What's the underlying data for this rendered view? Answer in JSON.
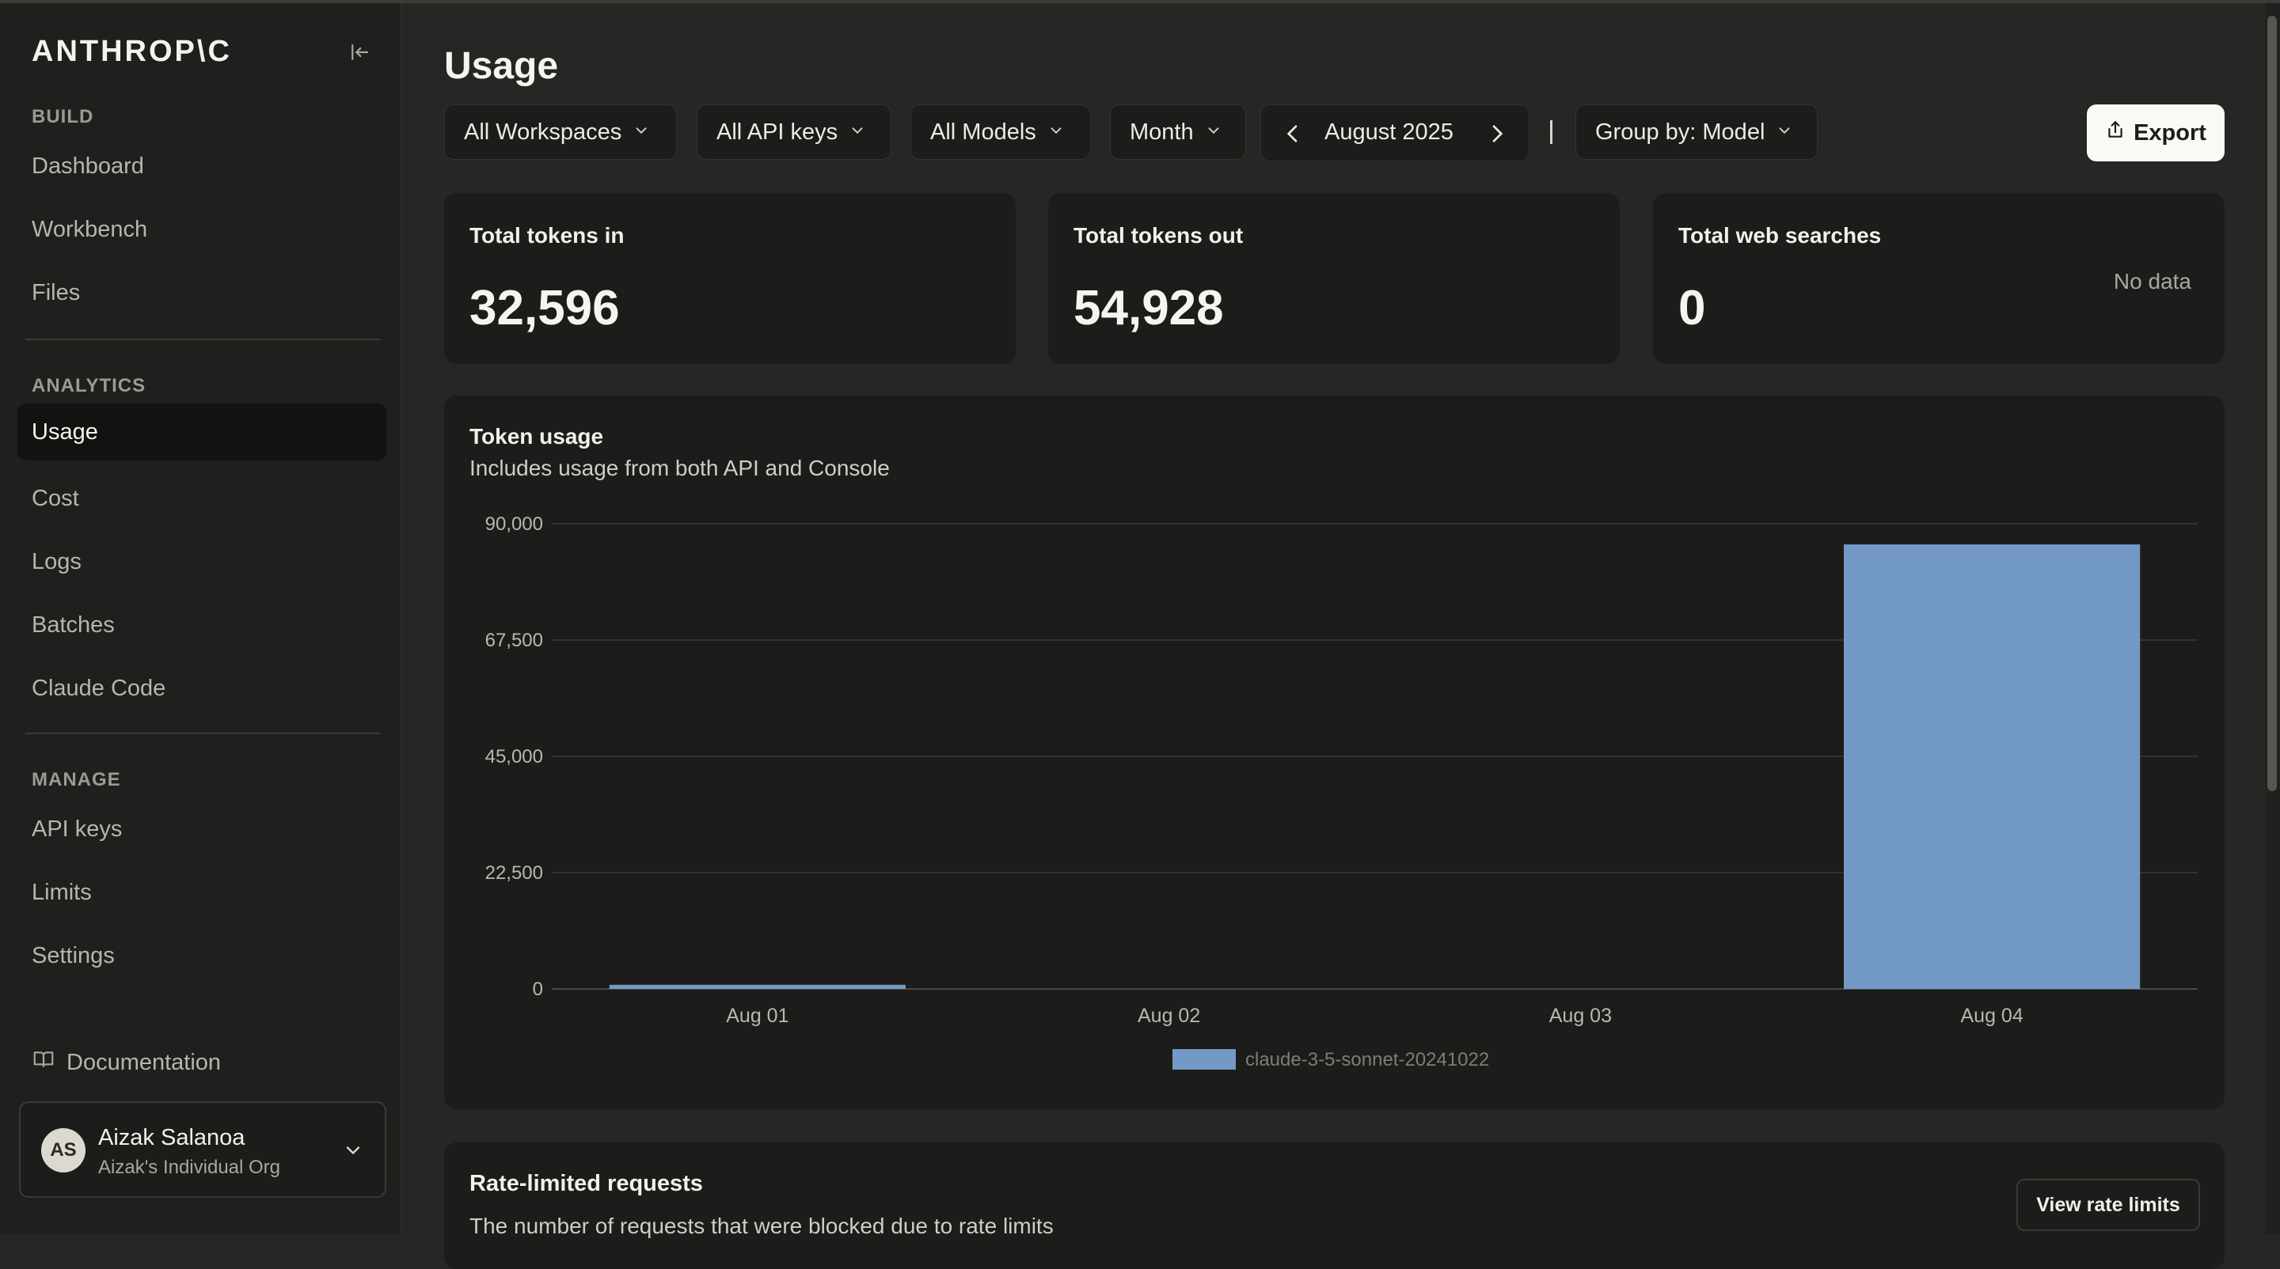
{
  "sidebar": {
    "logo": "ANTHROP\\C",
    "sections": [
      {
        "label": "BUILD",
        "items": [
          {
            "label": "Dashboard"
          },
          {
            "label": "Workbench"
          },
          {
            "label": "Files"
          }
        ]
      },
      {
        "label": "ANALYTICS",
        "items": [
          {
            "label": "Usage",
            "active": true
          },
          {
            "label": "Cost"
          },
          {
            "label": "Logs"
          },
          {
            "label": "Batches"
          },
          {
            "label": "Claude Code"
          }
        ]
      },
      {
        "label": "MANAGE",
        "items": [
          {
            "label": "API keys"
          },
          {
            "label": "Limits"
          },
          {
            "label": "Settings"
          }
        ]
      }
    ],
    "documentation": "Documentation",
    "user": {
      "initials": "AS",
      "name": "Aizak Salanoa",
      "org": "Aizak's Individual Org"
    }
  },
  "header": {
    "title": "Usage",
    "filters": {
      "workspaces": "All Workspaces",
      "api_keys": "All API keys",
      "models": "All Models",
      "period": "Month",
      "date": "August 2025",
      "group_by": "Group by: Model"
    },
    "export_label": "Export"
  },
  "stats": [
    {
      "title": "Total tokens in",
      "value": "32,596"
    },
    {
      "title": "Total tokens out",
      "value": "54,928"
    },
    {
      "title": "Total web searches",
      "value": "0",
      "note": "No data"
    }
  ],
  "token_usage": {
    "title": "Token usage",
    "subtitle": "Includes usage from both API and Console"
  },
  "chart_data": {
    "type": "bar",
    "categories": [
      "Aug 01",
      "Aug 02",
      "Aug 03",
      "Aug 04"
    ],
    "series": [
      {
        "name": "claude-3-5-sonnet-20241022",
        "values": [
          800,
          0,
          0,
          86000
        ],
        "color": "#7399c6"
      }
    ],
    "yticks": [
      "0",
      "22,500",
      "45,000",
      "67,500",
      "90,000"
    ],
    "ylim": [
      0,
      90000
    ],
    "grid": true,
    "legend_position": "bottom-center"
  },
  "rate_limited": {
    "title": "Rate-limited requests",
    "subtitle": "The number of requests that were blocked due to rate limits",
    "button": "View rate limits"
  },
  "colors": {
    "accent_bar": "#7399c6",
    "background": "#262624",
    "card": "#1c1c1a"
  }
}
